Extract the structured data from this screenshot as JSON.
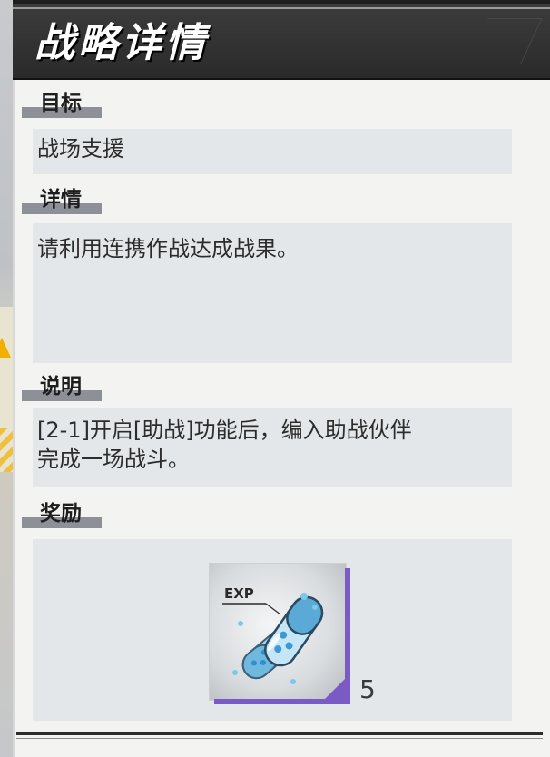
{
  "header": {
    "title": "战略详情"
  },
  "sections": {
    "target": {
      "label": "目标",
      "content": "战场支援"
    },
    "detail": {
      "label": "详情",
      "content": "请利用连携作战达成战果。"
    },
    "description": {
      "label": "说明",
      "content_line1": "[2-1]开启[助战]功能后，编入助战伙伴",
      "content_line2": "完成一场战斗。"
    },
    "reward": {
      "label": "奖励",
      "item": {
        "icon": "exp-capsule-icon",
        "badge_text": "EXP",
        "quantity": "5",
        "rarity_color": "#7a5bc4"
      }
    }
  },
  "colors": {
    "header_bg": "#2a2a2a",
    "panel_bg": "#f3f3f2",
    "content_box_bg": "#e4e7ea",
    "label_bar": "#8d9096"
  }
}
